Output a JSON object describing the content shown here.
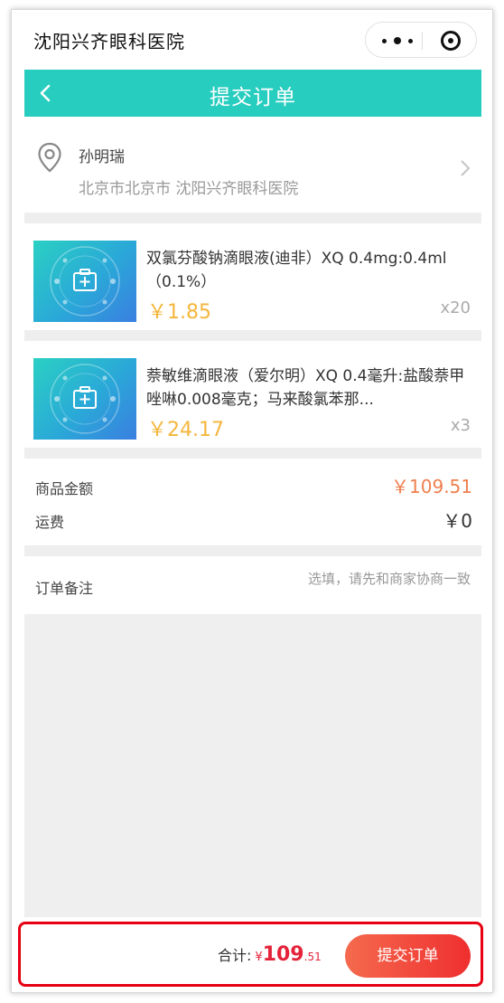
{
  "miniprogram": {
    "title": "沈阳兴齐眼科医院"
  },
  "nav": {
    "title": "提交订单"
  },
  "address": {
    "name": "孙明瑞",
    "detail": "北京市北京市 沈阳兴齐眼科医院"
  },
  "items": [
    {
      "name": "双氯芬酸钠滴眼液(迪非）XQ 0.4mg:0.4ml（0.1%）",
      "price": "￥1.85",
      "qty": "x20"
    },
    {
      "name": "萘敏维滴眼液（爱尔明）XQ 0.4毫升:盐酸萘甲唑啉0.008毫克；马来酸氯苯那...",
      "price": "￥24.17",
      "qty": "x3"
    }
  ],
  "summary": {
    "goods_label": "商品金额",
    "goods_value": "￥109.51",
    "shipping_label": "运费",
    "shipping_value": "￥0"
  },
  "remarks": {
    "label": "订单备注",
    "placeholder": "选填，请先和商家协商一致"
  },
  "footer": {
    "total_label": "合计:",
    "total_currency": "¥",
    "total_integer": "109",
    "total_decimal": ".51",
    "submit_label": "提交订单"
  },
  "colors": {
    "nav": "#27cdbf",
    "price": "#f4b63c",
    "goods_amount": "#ef7f4e",
    "total": "#e4233a",
    "highlight": "#e60012"
  },
  "icons": [
    "more-dots-icon",
    "target-icon",
    "back-arrow-icon",
    "location-pin-icon",
    "chevron-right-icon",
    "medical-kit-icon"
  ]
}
